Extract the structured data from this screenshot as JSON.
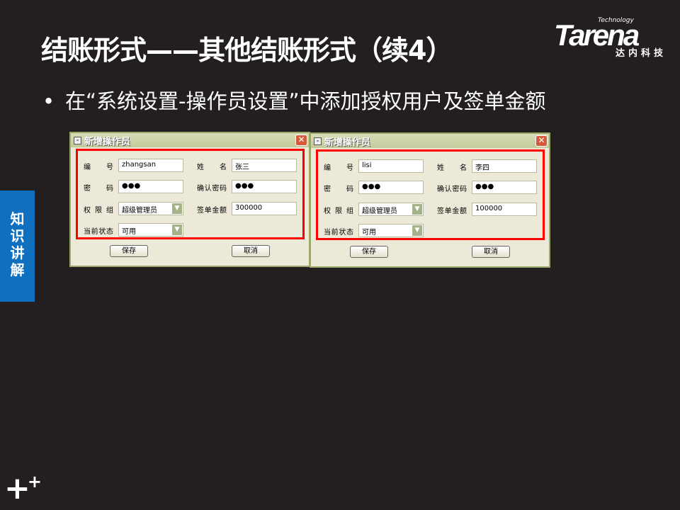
{
  "slide": {
    "title": "结账形式——其他结账形式（续4）",
    "bullet_marker": "•",
    "bullet": "在“系统设置-操作员设置”中添加授权用户及签单金额",
    "side_tab": "知识讲解",
    "plus_icon": "+"
  },
  "logo": {
    "tech": "Technology",
    "brand": "Tarena",
    "cn": "达内科技"
  },
  "dialogs": [
    {
      "title": "新增操作员",
      "close": "✕",
      "labels": {
        "id": "编号",
        "pwd": "密码",
        "group": "权限组",
        "status": "当前状态",
        "name": "姓名",
        "confirm": "确认密码",
        "amount": "签单金额"
      },
      "values": {
        "id": "zhangsan",
        "pwd": "●●●",
        "group": "超级管理员",
        "status": "可用",
        "name": "张三",
        "confirm": "●●●",
        "amount": "300000"
      },
      "save": "保存",
      "cancel": "取消"
    },
    {
      "title": "新增操作员",
      "close": "✕",
      "labels": {
        "id": "编号",
        "pwd": "密码",
        "group": "权限组",
        "status": "当前状态",
        "name": "姓名",
        "confirm": "确认密码",
        "amount": "签单金额"
      },
      "values": {
        "id": "lisi",
        "pwd": "●●●",
        "group": "超级管理员",
        "status": "可用",
        "name": "李四",
        "confirm": "●●●",
        "amount": "100000"
      },
      "save": "保存",
      "cancel": "取消"
    }
  ]
}
